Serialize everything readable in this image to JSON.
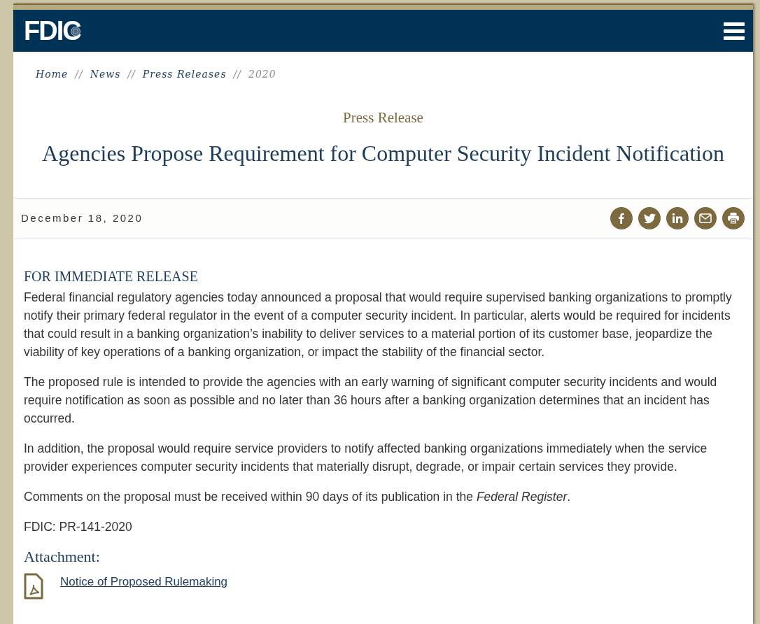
{
  "header": {
    "logo": "FDIC"
  },
  "breadcrumbs": [
    {
      "label": "Home",
      "current": false
    },
    {
      "label": "News",
      "current": false
    },
    {
      "label": "Press Releases",
      "current": false
    },
    {
      "label": "2020",
      "current": true
    }
  ],
  "breadcrumb_separator": "//",
  "kicker": "Press Release",
  "title": "Agencies Propose Requirement for Computer Security Incident Notification",
  "date": "December 18, 2020",
  "share_buttons": [
    {
      "kind": "facebook"
    },
    {
      "kind": "twitter"
    },
    {
      "kind": "linkedin"
    },
    {
      "kind": "email"
    },
    {
      "kind": "print"
    }
  ],
  "release_label": "FOR IMMEDIATE RELEASE",
  "paragraphs": [
    "Federal financial regulatory agencies today announced a proposal that would require supervised banking organizations to promptly notify their primary federal regulator in the event of a computer security incident. In particular, alerts would be required for incidents that could result in a banking organization’s inability to deliver services to a material portion of its customer base, jeopardize the viability of key operations of a banking organization, or impact the stability of the financial sector.",
    "The proposed rule is intended to provide the agencies with an early warning of significant computer security incidents and would require notification as soon as possible and no later than 36 hours after a banking organization determines that an incident has occurred.",
    "In addition, the proposal would require service providers to notify affected banking organizations immediately when the service provider experiences computer security incidents that materially disrupt, degrade, or impair certain services they provide.",
    "Comments on the proposal must be received within 90 days of its publication in the *Federal Register*.",
    "FDIC: PR-141-2020"
  ],
  "attachments_heading": "Attachment:",
  "attachments": [
    {
      "label": "Notice of Proposed Rulemaking"
    }
  ]
}
